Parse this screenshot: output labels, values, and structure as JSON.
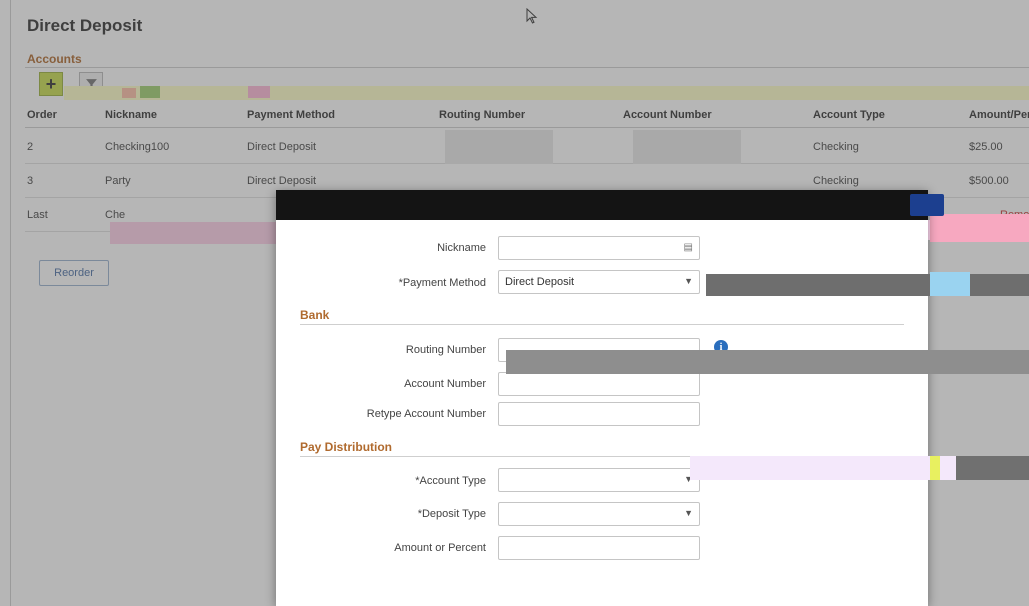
{
  "page": {
    "title": "Direct Deposit",
    "section_title": "Accounts",
    "reorder_label": "Reorder"
  },
  "toolbar": {
    "add_label": "+",
    "filter_icon": "filter-icon"
  },
  "table": {
    "columns": [
      "Order",
      "Nickname",
      "Payment Method",
      "Routing Number",
      "Account Number",
      "Account Type",
      "Amount/Percent"
    ],
    "rows": [
      {
        "order": "2",
        "nickname": "Checking100",
        "payment_method": "Direct Deposit",
        "account_type": "Checking",
        "amount": "$25.00"
      },
      {
        "order": "3",
        "nickname": "Party",
        "payment_method": "Direct Deposit",
        "account_type": "Checking",
        "amount": "$500.00"
      },
      {
        "order": "Last",
        "nickname": "Che",
        "payment_method": "",
        "account_type": "",
        "amount": "Remo"
      }
    ]
  },
  "modal": {
    "nickname_label": "Nickname",
    "payment_method_label": "*Payment Method",
    "payment_method_value": "Direct Deposit",
    "bank_title": "Bank",
    "routing_label": "Routing Number",
    "account_label": "Account Number",
    "retype_label": "Retype Account Number",
    "pay_distribution_title": "Pay Distribution",
    "account_type_label": "*Account Type",
    "deposit_type_label": "*Deposit Type",
    "amount_label": "Amount or Percent"
  },
  "colors": {
    "accent_orange": "#b06a2e",
    "add_button": "#c9dd4e",
    "header_dark": "#141414",
    "link_red": "#cc3333"
  }
}
